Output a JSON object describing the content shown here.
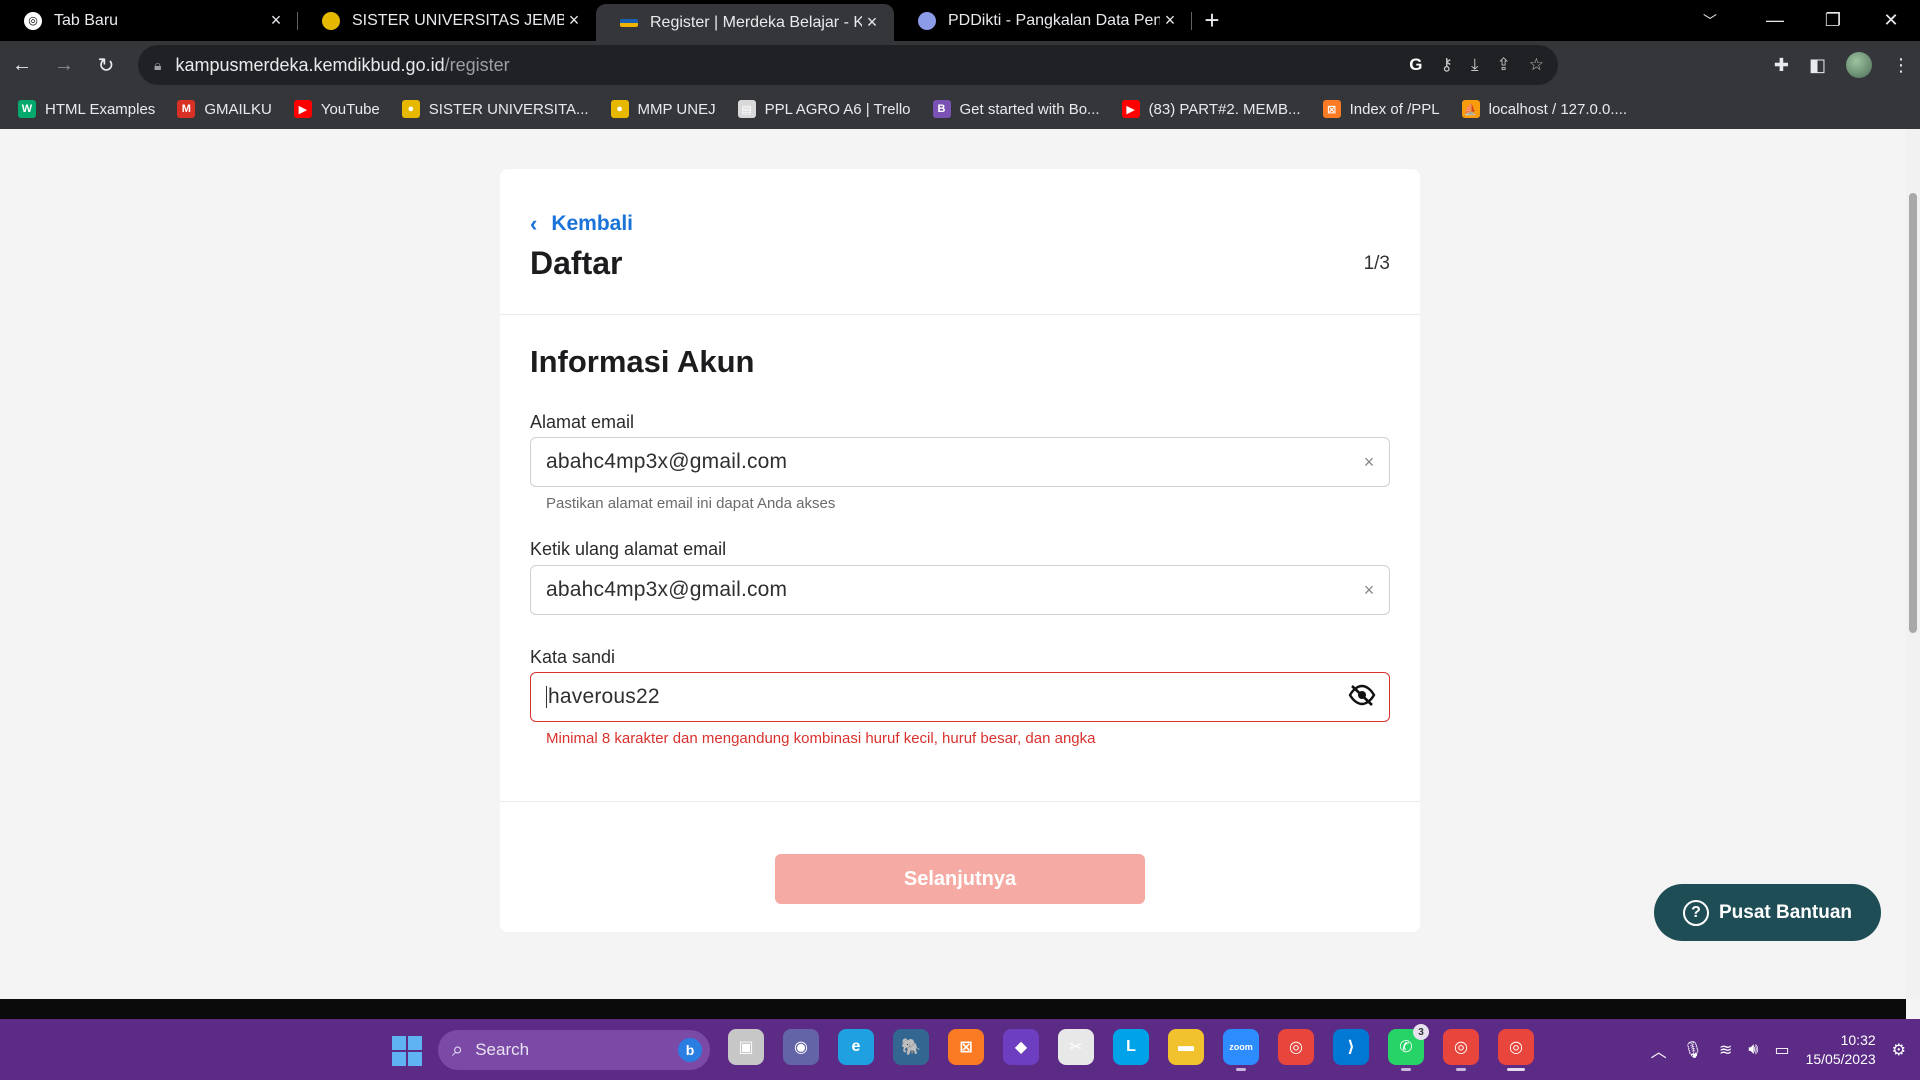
{
  "browser": {
    "tabs": [
      {
        "title": "Tab Baru",
        "active": false
      },
      {
        "title": "SISTER UNIVERSITAS JEMBER",
        "active": false
      },
      {
        "title": "Register | Merdeka Belajar - Kam",
        "active": true
      },
      {
        "title": "PDDikti - Pangkalan Data Pendid",
        "active": false
      }
    ],
    "address": {
      "host": "kampusmerdeka.kemdikbud.go.id",
      "path": "/register"
    },
    "bookmarks": [
      {
        "label": "HTML Examples",
        "icon": "w3schools-icon",
        "color": "#04aa6d",
        "glyph": "W"
      },
      {
        "label": "GMAILKU",
        "icon": "gmail-icon",
        "color": "#d93025",
        "glyph": "M"
      },
      {
        "label": "YouTube",
        "icon": "youtube-icon",
        "color": "#ff0000",
        "glyph": "▶"
      },
      {
        "label": "SISTER UNIVERSITA...",
        "icon": "unej-logo-icon",
        "color": "#e6b800",
        "glyph": "●"
      },
      {
        "label": "MMP UNEJ",
        "icon": "unej-logo-icon",
        "color": "#e6b800",
        "glyph": "●"
      },
      {
        "label": "PPL AGRO A6 | Trello",
        "icon": "trello-icon",
        "color": "#d9d9d9",
        "glyph": "▤"
      },
      {
        "label": "Get started with Bo...",
        "icon": "bootstrap-icon",
        "color": "#7952b3",
        "glyph": "B"
      },
      {
        "label": "(83) PART#2. MEMB...",
        "icon": "youtube-icon",
        "color": "#ff0000",
        "glyph": "▶"
      },
      {
        "label": "Index of /PPL",
        "icon": "xampp-icon",
        "color": "#fb7a24",
        "glyph": "⊠"
      },
      {
        "label": "localhost / 127.0.0....",
        "icon": "phpmyadmin-icon",
        "color": "#f89c0e",
        "glyph": "⛵"
      }
    ]
  },
  "page": {
    "back_label": "Kembali",
    "title": "Daftar",
    "step": "1/3",
    "section_title": "Informasi Akun",
    "email": {
      "label": "Alamat email",
      "value": "abahc4mp3x@gmail.com",
      "hint": "Pastikan alamat email ini dapat Anda akses"
    },
    "email_confirm": {
      "label": "Ketik ulang alamat email",
      "value": "abahc4mp3x@gmail.com"
    },
    "password": {
      "label": "Kata sandi",
      "value": "haverous22",
      "error": "Minimal 8 karakter dan mengandung kombinasi huruf kecil, huruf besar, dan angka"
    },
    "next_button": "Selanjutnya",
    "help_button": "Pusat Bantuan"
  },
  "taskbar": {
    "search_label": "Search",
    "whatsapp_badge": "3",
    "time": "10:32",
    "date": "15/05/2023",
    "apps": [
      {
        "name": "task-view-icon",
        "color": "#c7c7c7",
        "glyph": "▣"
      },
      {
        "name": "teams-chat-icon",
        "color": "#6264a7",
        "glyph": "◉"
      },
      {
        "name": "edge-icon",
        "color": "#1fa0e0",
        "glyph": "e"
      },
      {
        "name": "postgresql-icon",
        "color": "#336791",
        "glyph": "🐘"
      },
      {
        "name": "xampp-icon",
        "color": "#fb7a24",
        "glyph": "⊠"
      },
      {
        "name": "visual-studio-icon",
        "color": "#6d3fc0",
        "glyph": "◆"
      },
      {
        "name": "snipping-tool-icon",
        "color": "#e8e8e8",
        "glyph": "✂"
      },
      {
        "name": "launcher-l-icon",
        "color": "#00a2e8",
        "glyph": "L"
      },
      {
        "name": "file-explorer-icon",
        "color": "#f2c12e",
        "glyph": "▬"
      },
      {
        "name": "zoom-icon",
        "color": "#2d8cff",
        "glyph": "zoom"
      },
      {
        "name": "chrome-icon",
        "color": "#e8453c",
        "glyph": "◎"
      },
      {
        "name": "vscode-icon",
        "color": "#0078d4",
        "glyph": "⟩"
      },
      {
        "name": "whatsapp-icon",
        "color": "#25d366",
        "glyph": "✆"
      },
      {
        "name": "chrome-profile-icon",
        "color": "#e8453c",
        "glyph": "◎"
      },
      {
        "name": "chrome-profile-icon",
        "color": "#e8453c",
        "glyph": "◎"
      }
    ]
  }
}
